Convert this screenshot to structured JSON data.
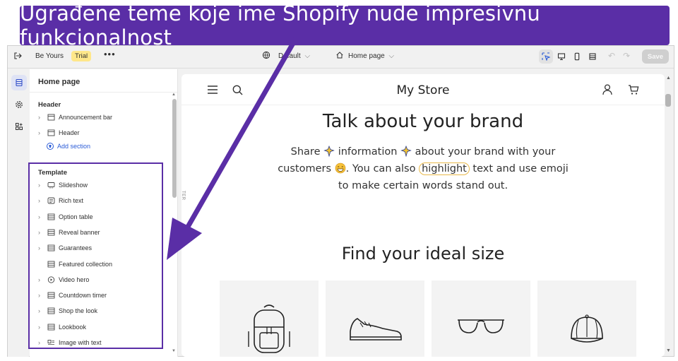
{
  "banner": {
    "text": "Ugrađene teme koje ime Shopify nude impresivnu funkcionalnost"
  },
  "topbar": {
    "store_name": "Be Yours",
    "trial_badge": "Trial",
    "theme_select": "Default",
    "page_select": "Home page",
    "save_label": "Save"
  },
  "sidebar": {
    "title": "Home page",
    "header_group": "Header",
    "header_items": [
      {
        "label": "Announcement bar"
      },
      {
        "label": "Header"
      }
    ],
    "add_section": "Add section",
    "template_group": "Template",
    "template_items": [
      {
        "label": "Slideshow",
        "icon": "slideshow-icon"
      },
      {
        "label": "Rich text",
        "icon": "rich-text-icon"
      },
      {
        "label": "Option table",
        "icon": "table-icon"
      },
      {
        "label": "Reveal banner",
        "icon": "section-icon"
      },
      {
        "label": "Guarantees",
        "icon": "section-icon"
      },
      {
        "label": "Featured collection",
        "icon": "section-icon"
      },
      {
        "label": "Video hero",
        "icon": "play-icon"
      },
      {
        "label": "Countdown timer",
        "icon": "section-icon"
      },
      {
        "label": "Shop the look",
        "icon": "section-icon"
      },
      {
        "label": "Lookbook",
        "icon": "section-icon"
      },
      {
        "label": "Image with text",
        "icon": "image-text-icon"
      }
    ]
  },
  "preview": {
    "store_title": "My Store",
    "rich_heading": "Talk about your brand",
    "rich_body": {
      "p1": "Share ",
      "p2": " information ",
      "p3": " about your brand with your customers ",
      "p4": ". You can also ",
      "highlight": "highlight",
      "p5": " text and  use emoji  to make certain words stand out."
    },
    "size_heading": "Find your ideal size",
    "side_label": "TER"
  },
  "colors": {
    "banner": "#5a2ea6",
    "accent_link": "#2a5bd7",
    "trial_badge": "#ffe78a",
    "highlight_ring": "#e9b949"
  }
}
